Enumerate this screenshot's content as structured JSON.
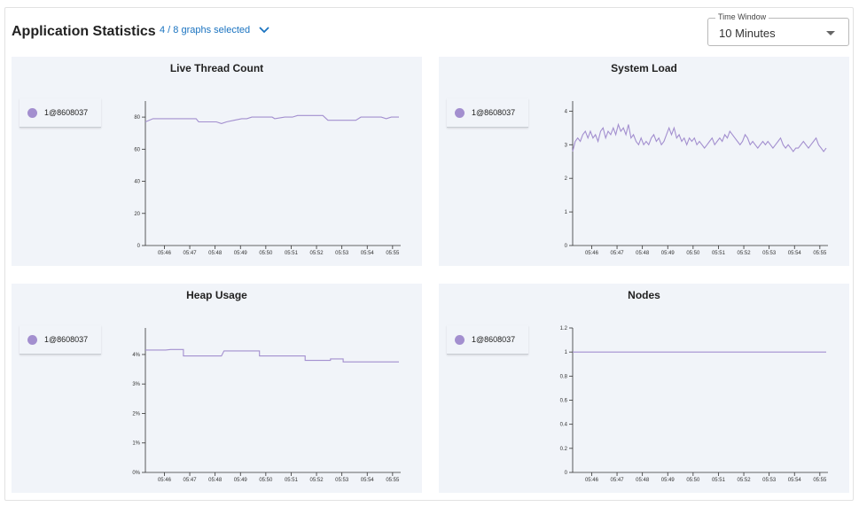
{
  "header": {
    "title": "Application Statistics",
    "graph_selector": "4 / 8 graphs selected",
    "time_window_label": "Time Window",
    "time_window_value": "10 Minutes"
  },
  "colors": {
    "series": "#a38fcf",
    "link": "#1a73c0",
    "panel_bg": "#f1f4f9"
  },
  "icons": {
    "graph_selector": "chevron-down-icon",
    "time_window": "caret-down-icon"
  },
  "chart_data": [
    {
      "type": "line",
      "title": "Live Thread Count",
      "legend": [
        "1@8608037"
      ],
      "x_ticks": [
        "05:46",
        "05:47",
        "05:48",
        "05:49",
        "05:50",
        "05:51",
        "05:52",
        "05:53",
        "05:54",
        "05:55"
      ],
      "xlim": [
        0,
        10
      ],
      "ylim": [
        0,
        90
      ],
      "y_ticks": [
        0,
        20,
        40,
        60,
        80
      ],
      "y_tick_labels": [
        "0",
        "20",
        "40",
        "60",
        "80"
      ],
      "series": [
        {
          "name": "1@8608037",
          "points": [
            [
              0,
              77
            ],
            [
              0.3,
              79
            ],
            [
              0.6,
              79
            ],
            [
              1.0,
              79
            ],
            [
              1.5,
              79
            ],
            [
              2.0,
              79
            ],
            [
              2.1,
              77
            ],
            [
              2.5,
              77
            ],
            [
              2.8,
              77
            ],
            [
              3.0,
              76
            ],
            [
              3.2,
              77
            ],
            [
              3.5,
              78
            ],
            [
              3.8,
              79
            ],
            [
              4.0,
              79
            ],
            [
              4.2,
              80
            ],
            [
              4.5,
              80
            ],
            [
              4.8,
              80
            ],
            [
              5.0,
              80
            ],
            [
              5.1,
              79
            ],
            [
              5.5,
              80
            ],
            [
              5.8,
              80
            ],
            [
              6.0,
              81
            ],
            [
              6.4,
              81
            ],
            [
              6.8,
              81
            ],
            [
              7.0,
              81
            ],
            [
              7.2,
              78
            ],
            [
              7.6,
              78
            ],
            [
              8.0,
              78
            ],
            [
              8.3,
              78
            ],
            [
              8.5,
              80
            ],
            [
              8.8,
              80
            ],
            [
              9.1,
              80
            ],
            [
              9.3,
              80
            ],
            [
              9.5,
              79
            ],
            [
              9.7,
              80
            ],
            [
              10.0,
              80
            ]
          ]
        }
      ]
    },
    {
      "type": "line",
      "title": "System Load",
      "legend": [
        "1@8608037"
      ],
      "x_ticks": [
        "05:46",
        "05:47",
        "05:48",
        "05:49",
        "05:50",
        "05:51",
        "05:52",
        "05:53",
        "05:54",
        "05:55"
      ],
      "xlim": [
        0,
        10
      ],
      "ylim": [
        0,
        4.3
      ],
      "y_ticks": [
        0,
        1,
        2,
        3,
        4
      ],
      "y_tick_labels": [
        "0",
        "1",
        "2",
        "3",
        "4"
      ],
      "series": [
        {
          "name": "1@8608037",
          "points": [
            [
              0,
              2.8
            ],
            [
              0.1,
              3.1
            ],
            [
              0.2,
              3.2
            ],
            [
              0.3,
              3.1
            ],
            [
              0.4,
              3.3
            ],
            [
              0.5,
              3.4
            ],
            [
              0.6,
              3.2
            ],
            [
              0.7,
              3.4
            ],
            [
              0.8,
              3.2
            ],
            [
              0.9,
              3.3
            ],
            [
              1.0,
              3.1
            ],
            [
              1.1,
              3.4
            ],
            [
              1.2,
              3.5
            ],
            [
              1.3,
              3.2
            ],
            [
              1.4,
              3.4
            ],
            [
              1.5,
              3.3
            ],
            [
              1.6,
              3.5
            ],
            [
              1.7,
              3.3
            ],
            [
              1.8,
              3.6
            ],
            [
              1.9,
              3.4
            ],
            [
              2.0,
              3.5
            ],
            [
              2.1,
              3.3
            ],
            [
              2.2,
              3.6
            ],
            [
              2.3,
              3.2
            ],
            [
              2.4,
              3.3
            ],
            [
              2.5,
              3.1
            ],
            [
              2.6,
              3.0
            ],
            [
              2.7,
              3.2
            ],
            [
              2.8,
              3.0
            ],
            [
              2.9,
              3.1
            ],
            [
              3.0,
              3.0
            ],
            [
              3.1,
              3.2
            ],
            [
              3.2,
              3.3
            ],
            [
              3.3,
              3.1
            ],
            [
              3.4,
              3.2
            ],
            [
              3.5,
              3.0
            ],
            [
              3.6,
              3.1
            ],
            [
              3.7,
              3.3
            ],
            [
              3.8,
              3.5
            ],
            [
              3.9,
              3.3
            ],
            [
              4.0,
              3.5
            ],
            [
              4.1,
              3.2
            ],
            [
              4.2,
              3.3
            ],
            [
              4.3,
              3.1
            ],
            [
              4.4,
              3.2
            ],
            [
              4.5,
              3.0
            ],
            [
              4.6,
              3.2
            ],
            [
              4.7,
              3.1
            ],
            [
              4.8,
              3.2
            ],
            [
              4.9,
              3.0
            ],
            [
              5.0,
              3.1
            ],
            [
              5.1,
              3.0
            ],
            [
              5.2,
              2.9
            ],
            [
              5.3,
              3.0
            ],
            [
              5.4,
              3.1
            ],
            [
              5.5,
              3.2
            ],
            [
              5.6,
              3.0
            ],
            [
              5.7,
              3.1
            ],
            [
              5.8,
              3.2
            ],
            [
              5.9,
              3.1
            ],
            [
              6.0,
              3.3
            ],
            [
              6.1,
              3.2
            ],
            [
              6.2,
              3.4
            ],
            [
              6.3,
              3.3
            ],
            [
              6.4,
              3.2
            ],
            [
              6.5,
              3.1
            ],
            [
              6.6,
              3.0
            ],
            [
              6.7,
              3.1
            ],
            [
              6.8,
              3.3
            ],
            [
              6.9,
              3.2
            ],
            [
              7.0,
              3.0
            ],
            [
              7.1,
              3.1
            ],
            [
              7.2,
              3.0
            ],
            [
              7.3,
              2.9
            ],
            [
              7.4,
              3.0
            ],
            [
              7.5,
              3.1
            ],
            [
              7.6,
              3.0
            ],
            [
              7.7,
              3.1
            ],
            [
              7.8,
              3.0
            ],
            [
              7.9,
              2.9
            ],
            [
              8.0,
              3.0
            ],
            [
              8.1,
              3.1
            ],
            [
              8.2,
              3.2
            ],
            [
              8.3,
              3.0
            ],
            [
              8.4,
              2.9
            ],
            [
              8.5,
              3.0
            ],
            [
              8.6,
              2.9
            ],
            [
              8.7,
              2.8
            ],
            [
              8.8,
              2.9
            ],
            [
              8.9,
              2.9
            ],
            [
              9.0,
              3.0
            ],
            [
              9.1,
              3.1
            ],
            [
              9.2,
              3.0
            ],
            [
              9.3,
              2.9
            ],
            [
              9.4,
              3.0
            ],
            [
              9.5,
              3.1
            ],
            [
              9.6,
              3.2
            ],
            [
              9.7,
              3.0
            ],
            [
              9.8,
              2.9
            ],
            [
              9.9,
              2.8
            ],
            [
              10.0,
              2.9
            ]
          ]
        }
      ]
    },
    {
      "type": "line",
      "title": "Heap Usage",
      "legend": [
        "1@8608037"
      ],
      "x_ticks": [
        "05:46",
        "05:47",
        "05:48",
        "05:49",
        "05:50",
        "05:51",
        "05:52",
        "05:53",
        "05:54",
        "05:55"
      ],
      "xlim": [
        0,
        10
      ],
      "ylim": [
        0,
        4.9
      ],
      "y_ticks": [
        0,
        1,
        2,
        3,
        4
      ],
      "y_tick_labels": [
        "0%",
        "1%",
        "2%",
        "3%",
        "4%"
      ],
      "series": [
        {
          "name": "1@8608037",
          "points": [
            [
              0,
              4.15
            ],
            [
              0.8,
              4.15
            ],
            [
              1.0,
              4.17
            ],
            [
              1.5,
              4.17
            ],
            [
              1.5,
              3.95
            ],
            [
              2.0,
              3.95
            ],
            [
              3.0,
              3.95
            ],
            [
              3.1,
              4.12
            ],
            [
              3.5,
              4.12
            ],
            [
              4.0,
              4.12
            ],
            [
              4.5,
              4.12
            ],
            [
              4.5,
              3.95
            ],
            [
              5.0,
              3.95
            ],
            [
              5.5,
              3.95
            ],
            [
              6.3,
              3.95
            ],
            [
              6.3,
              3.8
            ],
            [
              7.0,
              3.8
            ],
            [
              7.3,
              3.8
            ],
            [
              7.3,
              3.85
            ],
            [
              7.8,
              3.85
            ],
            [
              7.8,
              3.75
            ],
            [
              8.5,
              3.75
            ],
            [
              9.0,
              3.75
            ],
            [
              10.0,
              3.75
            ]
          ]
        }
      ]
    },
    {
      "type": "line",
      "title": "Nodes",
      "legend": [
        "1@8608037"
      ],
      "x_ticks": [
        "05:46",
        "05:47",
        "05:48",
        "05:49",
        "05:50",
        "05:51",
        "05:52",
        "05:53",
        "05:54",
        "05:55"
      ],
      "xlim": [
        0,
        10
      ],
      "ylim": [
        0,
        1.2
      ],
      "y_ticks": [
        0,
        0.2,
        0.4,
        0.6,
        0.8,
        1,
        1.2
      ],
      "y_tick_labels": [
        "0",
        "0.2",
        "0.4",
        "0.6",
        "0.8",
        "1",
        "1.2"
      ],
      "series": [
        {
          "name": "1@8608037",
          "points": [
            [
              0,
              1
            ],
            [
              10,
              1
            ]
          ]
        }
      ]
    }
  ]
}
